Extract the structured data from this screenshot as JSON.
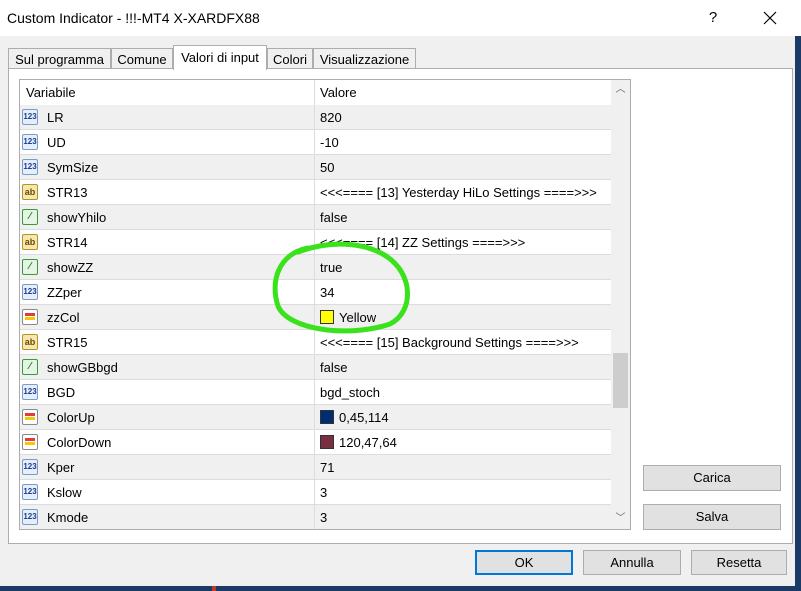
{
  "window": {
    "title": "Custom Indicator - !!!-MT4 X-XARDFX88",
    "help_label": "?"
  },
  "tabs": [
    {
      "label": "Sul programma"
    },
    {
      "label": "Comune"
    },
    {
      "label": "Valori di input"
    },
    {
      "label": "Colori"
    },
    {
      "label": "Visualizzazione"
    }
  ],
  "active_tab": "Valori di input",
  "grid": {
    "col_variable": "Variabile",
    "col_value": "Valore",
    "rows": [
      {
        "type": "int",
        "icon": "int-icon",
        "icon_text": "123",
        "name": "LR",
        "value": "820"
      },
      {
        "type": "int",
        "icon": "int-icon",
        "icon_text": "123",
        "name": "UD",
        "value": "-10"
      },
      {
        "type": "int",
        "icon": "int-icon",
        "icon_text": "123",
        "name": "SymSize",
        "value": "50"
      },
      {
        "type": "str",
        "icon": "string-icon",
        "icon_text": "ab",
        "name": "STR13",
        "value": "<<<==== [13] Yesterday HiLo Settings ====>>>"
      },
      {
        "type": "bool",
        "icon": "bool-icon",
        "icon_text": "⁄",
        "name": "showYhilo",
        "value": "false"
      },
      {
        "type": "str",
        "icon": "string-icon",
        "icon_text": "ab",
        "name": "STR14",
        "value": "<<<==== [14] ZZ Settings ====>>>"
      },
      {
        "type": "bool",
        "icon": "bool-icon",
        "icon_text": "⁄",
        "name": "showZZ",
        "value": "true"
      },
      {
        "type": "int",
        "icon": "int-icon",
        "icon_text": "123",
        "name": "ZZper",
        "value": "34"
      },
      {
        "type": "color",
        "icon": "color-icon",
        "icon_text": "",
        "name": "zzCol",
        "value": "Yellow",
        "swatch": "#ffff00"
      },
      {
        "type": "str",
        "icon": "string-icon",
        "icon_text": "ab",
        "name": "STR15",
        "value": "<<<==== [15] Background Settings ====>>>"
      },
      {
        "type": "bool",
        "icon": "bool-icon",
        "icon_text": "⁄",
        "name": "showGBbgd",
        "value": "false"
      },
      {
        "type": "int",
        "icon": "int-icon",
        "icon_text": "123",
        "name": "BGD",
        "value": "bgd_stoch"
      },
      {
        "type": "color",
        "icon": "color-icon",
        "icon_text": "",
        "name": "ColorUp",
        "value": "0,45,114",
        "swatch": "#002d72"
      },
      {
        "type": "color",
        "icon": "color-icon",
        "icon_text": "",
        "name": "ColorDown",
        "value": "120,47,64",
        "swatch": "#782f40"
      },
      {
        "type": "int",
        "icon": "int-icon",
        "icon_text": "123",
        "name": "Kper",
        "value": "71"
      },
      {
        "type": "int",
        "icon": "int-icon",
        "icon_text": "123",
        "name": "Kslow",
        "value": "3"
      },
      {
        "type": "int",
        "icon": "int-icon",
        "icon_text": "123",
        "name": "Kmode",
        "value": "3"
      }
    ]
  },
  "side_buttons": {
    "load": "Carica",
    "save": "Salva"
  },
  "footer_buttons": {
    "ok": "OK",
    "cancel": "Annulla",
    "reset": "Resetta"
  },
  "colors": {
    "annotation": "#39e21b",
    "accent": "#0078d7"
  }
}
